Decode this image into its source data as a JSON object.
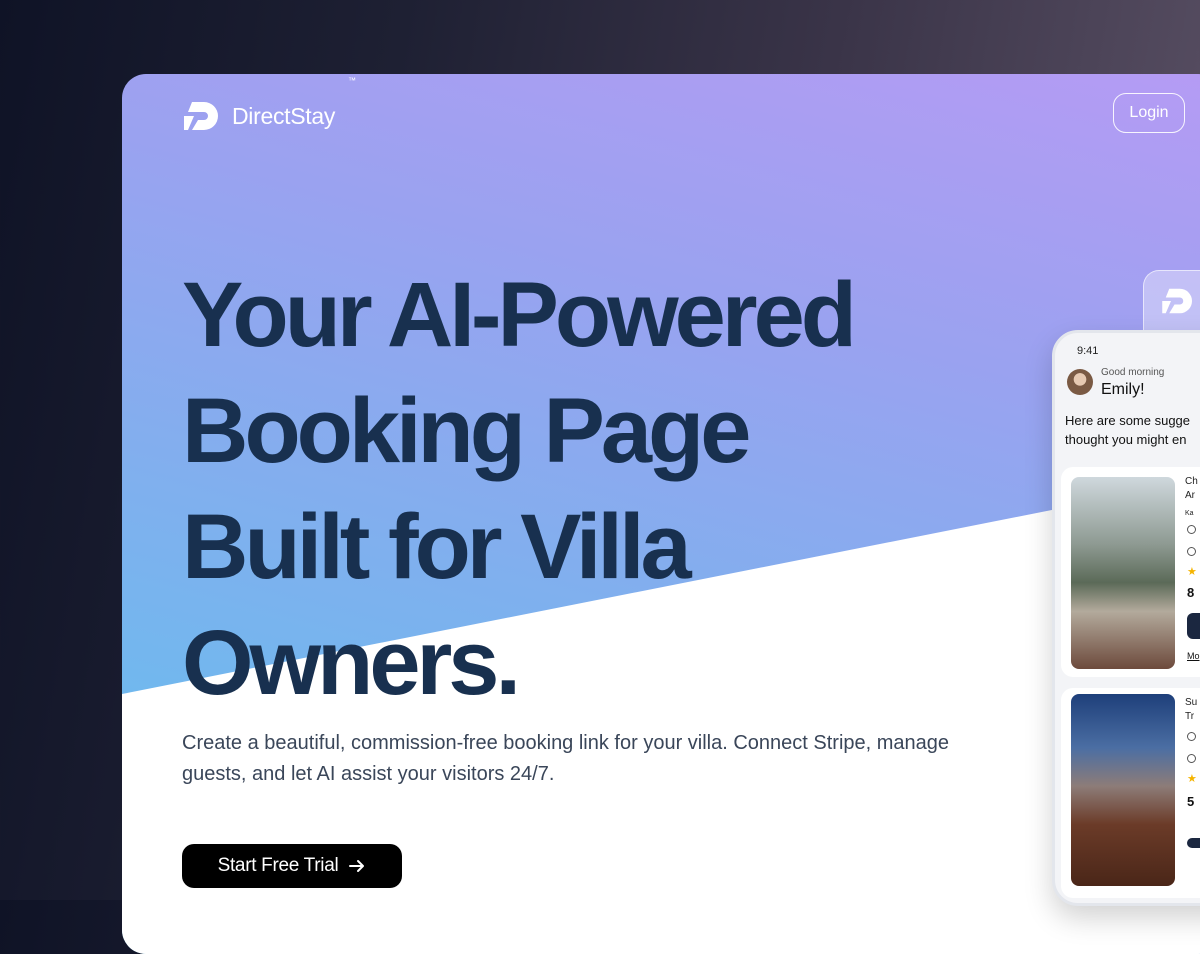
{
  "header": {
    "brand_name": "DirectStay",
    "brand_tm": "™",
    "login_label": "Login"
  },
  "hero": {
    "title_lines": [
      "Your AI-Powered",
      "Booking Page",
      "Built for Villa",
      "Owners."
    ],
    "subtitle_line1": "Create a beautiful, commission-free booking link for your villa. Connect Stripe, manage",
    "subtitle_line2": "guests, and let AI assist your visitors 24/7.",
    "cta_label": "Start Free Trial"
  },
  "phone": {
    "time": "9:41",
    "greeting": "Good morning",
    "user_name": "Emily!",
    "intro_line1": "Here are some sugge",
    "intro_line2": "thought you might en",
    "cards": [
      {
        "title_line1": "Ch",
        "title_line2": "Ar",
        "subtitle": "Ka",
        "price": "8",
        "more": "Mo"
      },
      {
        "title_line1": "Su",
        "title_line2": "Tr",
        "price": "5"
      }
    ]
  },
  "colors": {
    "title": "#18304f",
    "cta_bg": "#000000",
    "gradient_top": "#b59bf4",
    "gradient_bottom": "#5fc2ee"
  },
  "icons": [
    "directstay-logo-icon",
    "arrow-right-icon",
    "location-pin-icon",
    "clock-icon",
    "star-icon"
  ]
}
